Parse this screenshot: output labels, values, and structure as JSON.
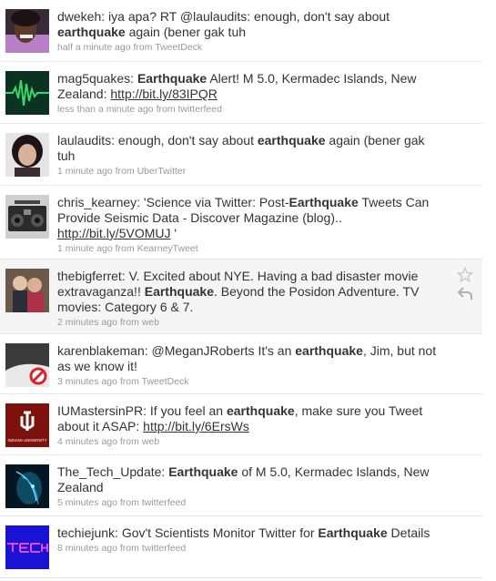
{
  "colors": {
    "text": "#333333",
    "meta": "#999999",
    "divider": "#e6e6e6",
    "hover_bg": "#f5f5f5"
  },
  "tweets": [
    {
      "user": "dwekeh",
      "parts": [
        ": iya apa? RT @laulaudits: enough, don't say about ",
        "earthquake",
        " again (bener gak tuh"
      ],
      "time": "half a minute ago",
      "from": "from",
      "source": "TweetDeck",
      "avatar_icon": "person-avatar-icon"
    },
    {
      "user": "mag5quakes",
      "parts": [
        ": ",
        "Earthquake",
        " Alert! M 5.0, Kermadec Islands, New Zealand: ",
        "http://bit.ly/83IPQR",
        ""
      ],
      "time": "less than a minute ago",
      "from": "from",
      "source": "twitterfeed",
      "avatar_icon": "seismograph-icon"
    },
    {
      "user": "laulaudits",
      "parts": [
        ": enough, don't say about ",
        "earthquake",
        " again (bener gak tuh"
      ],
      "time": "1 minute ago",
      "from": "from",
      "source": "UberTwitter",
      "avatar_icon": "person-avatar-icon"
    },
    {
      "user": "chris_kearney",
      "parts": [
        ": 'Science via Twitter: Post-",
        "Earthquake",
        " Tweets Can Provide Seismic Data - Discover Magazine (blog).. ",
        "http://bit.ly/5VOMUJ",
        " '"
      ],
      "time": "1 minute ago",
      "from": "from",
      "source": "KearneyTweet",
      "avatar_icon": "boombox-icon"
    },
    {
      "user": "thebigferret",
      "parts": [
        ": V. Excited about NYE. Having a bad disaster movie extravaganza!! ",
        "Earthquake",
        ". Beyond the Posidon Adventure. TV movies: Category 6 & 7."
      ],
      "time": "2 minutes ago",
      "from": "from",
      "source": "web",
      "avatar_icon": "group-photo-icon"
    },
    {
      "user": "karenblakeman",
      "parts": [
        ": @MeganJRoberts It's an ",
        "earthquake",
        ", Jim, but not as we know it!"
      ],
      "time": "3 minutes ago",
      "from": "from",
      "source": "TweetDeck",
      "avatar_icon": "no-sign-icon"
    },
    {
      "user": "IUMastersinPR",
      "parts": [
        ": If you feel an ",
        "earthquake",
        ", make sure you Tweet about it ASAP: ",
        "http://bit.ly/6ErsWs",
        ""
      ],
      "time": "4 minutes ago",
      "from": "from",
      "source": "web",
      "avatar_icon": "indiana-university-logo-icon",
      "avatar_caption": "INDIANA UNIVERSITY"
    },
    {
      "user": "The_Tech_Update",
      "parts": [
        ": ",
        "Earthquake",
        " of M 5.0, Kermadec Islands, New Zealand"
      ],
      "time": "5 minutes ago",
      "from": "from",
      "source": "twitterfeed",
      "avatar_icon": "glowing-face-icon"
    },
    {
      "user": "techiejunk",
      "parts": [
        ": Gov't Scientists Monitor Twitter for ",
        "Earthquake",
        " Details"
      ],
      "time": "8 minutes ago",
      "from": "from",
      "source": "twitterfeed",
      "avatar_icon": "tech-logo-icon"
    }
  ]
}
